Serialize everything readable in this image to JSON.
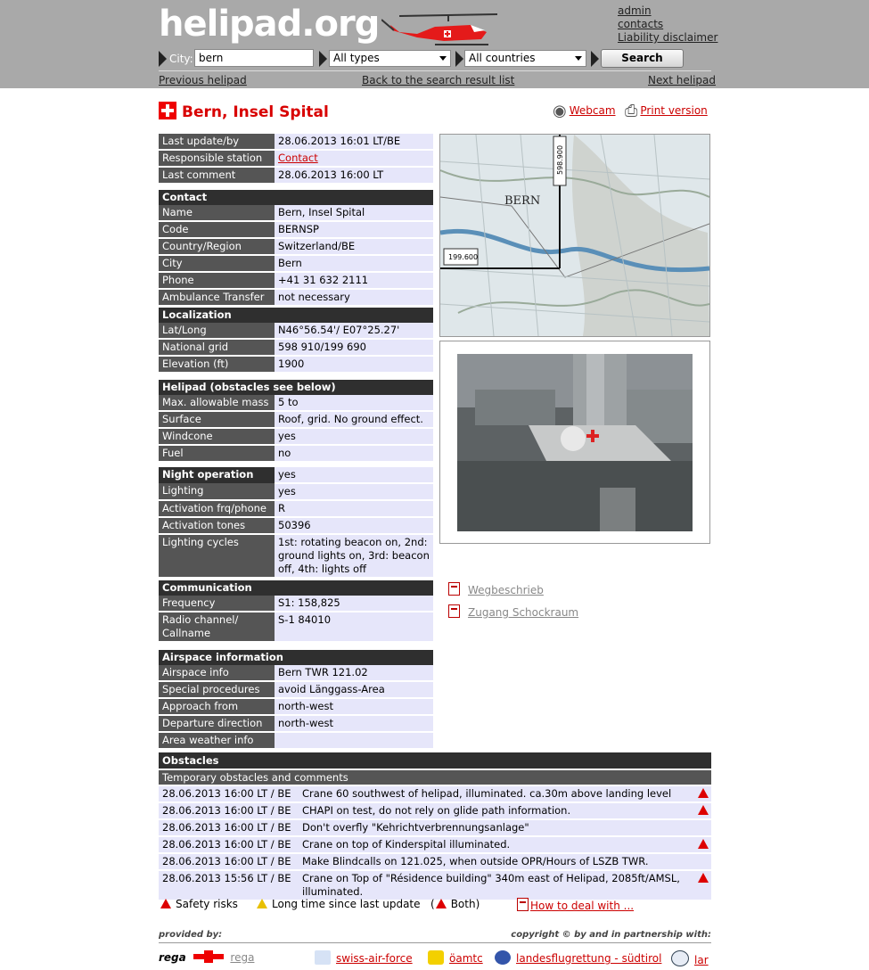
{
  "header": {
    "logo": "helipad.org",
    "links": [
      "admin",
      "contacts",
      "Liability disclaimer"
    ]
  },
  "search": {
    "city_label": "City:",
    "city_value": "bern",
    "type_select": "All types",
    "country_select": "All countries",
    "search_button": "Search"
  },
  "nav": {
    "previous": "Previous helipad",
    "back": "Back to the search result list",
    "next": "Next helipad"
  },
  "page": {
    "title": "Bern, Insel Spital",
    "webcam": "Webcam",
    "print": "Print version"
  },
  "meta": [
    {
      "k": "Last update/by",
      "v": "28.06.2013 16:01 LT/BE"
    },
    {
      "k": "Responsible station",
      "v": "Contact"
    },
    {
      "k": "Last comment",
      "v": "28.06.2013 16:00 LT"
    }
  ],
  "contact": {
    "heading": "Contact",
    "rows": [
      {
        "k": "Name",
        "v": "Bern, Insel Spital"
      },
      {
        "k": "Code",
        "v": "BERNSP"
      },
      {
        "k": "Country/Region",
        "v": "Switzerland/BE"
      },
      {
        "k": "City",
        "v": "Bern"
      },
      {
        "k": "Phone",
        "v": "+41 31 632 2111"
      },
      {
        "k": "Ambulance Transfer",
        "v": "not necessary"
      }
    ]
  },
  "localization": {
    "heading": "Localization",
    "rows": [
      {
        "k": "Lat/Long",
        "v": "N46°56.54'/ E07°25.27'"
      },
      {
        "k": "National grid",
        "v": "598 910/199 690"
      },
      {
        "k": "Elevation (ft)",
        "v": "1900"
      }
    ]
  },
  "helipad": {
    "heading": "Helipad (obstacles see below)",
    "rows": [
      {
        "k": "Max. allowable mass",
        "v": "5 to"
      },
      {
        "k": "Surface",
        "v": "Roof, grid. No ground effect."
      },
      {
        "k": "Windcone",
        "v": "yes"
      },
      {
        "k": "Fuel",
        "v": "no"
      }
    ]
  },
  "night": {
    "heading": "Night operation",
    "heading_value": "yes",
    "rows": [
      {
        "k": "Lighting",
        "v": "yes"
      },
      {
        "k": "Activation frq/phone",
        "v": "R"
      },
      {
        "k": "Activation tones",
        "v": "50396"
      },
      {
        "k": "Lighting cycles",
        "v": "1st: rotating beacon on, 2nd: ground lights on, 3rd: beacon off, 4th: lights off"
      }
    ]
  },
  "communication": {
    "heading": "Communication",
    "rows": [
      {
        "k": "Frequency",
        "v": "S1: 158,825"
      },
      {
        "k": "Radio channel/ Callname",
        "v": "S-1 84010"
      }
    ]
  },
  "airspace": {
    "heading": "Airspace information",
    "rows": [
      {
        "k": "Airspace info",
        "v": "Bern TWR 121.02"
      },
      {
        "k": "Special procedures",
        "v": "avoid Länggass-Area"
      },
      {
        "k": "Approach from",
        "v": "north-west"
      },
      {
        "k": "Departure direction",
        "v": "north-west"
      },
      {
        "k": "Area weather info",
        "v": ""
      }
    ]
  },
  "map": {
    "label_bern": "BERN",
    "grid_x": "598.900",
    "grid_y": "199.600"
  },
  "docs": [
    "Wegbeschrieb",
    "Zugang Schockraum"
  ],
  "obstacles": {
    "heading": "Obstacles",
    "subheading": "Temporary obstacles and comments",
    "rows": [
      {
        "date": "28.06.2013 16:00 LT / BE",
        "text": "Crane 60 southwest of helipad, illuminated. ca.30m above landing level",
        "risk": true
      },
      {
        "date": "28.06.2013 16:00 LT / BE",
        "text": "CHAPI on test, do not rely on glide path information.",
        "risk": true
      },
      {
        "date": "28.06.2013 16:00 LT / BE",
        "text": "Don't overfly \"Kehrichtverbrennungsanlage\"",
        "risk": false
      },
      {
        "date": "28.06.2013 16:00 LT / BE",
        "text": "Crane on top of Kinderspital illuminated.",
        "risk": true
      },
      {
        "date": "28.06.2013 16:00 LT / BE",
        "text": "Make Blindcalls on 121.025, when outside OPR/Hours of LSZB TWR.",
        "risk": false
      },
      {
        "date": "28.06.2013 15:56 LT / BE",
        "text": "Crane on Top of \"Résidence building\" 340m east of Helipad, 2085ft/AMSL, illuminated.",
        "risk": true
      }
    ]
  },
  "legend": {
    "safety": "Safety risks",
    "longtime": "Long time since last update",
    "both_open": "(",
    "both": "Both)",
    "howto": "How to deal with ..."
  },
  "footer": {
    "provided": "provided by:",
    "copyright": "copyright © by and in partnership with:",
    "partners": [
      "rega",
      "swiss-air-force",
      "öamtc",
      "landesflugrettung - südtirol",
      "lar"
    ],
    "rega_logo": "rega"
  },
  "colors": {
    "accent": "#cc0000",
    "header_bg": "#a9a9a9",
    "row_key": "#555555",
    "row_value": "#e6e6fa"
  }
}
